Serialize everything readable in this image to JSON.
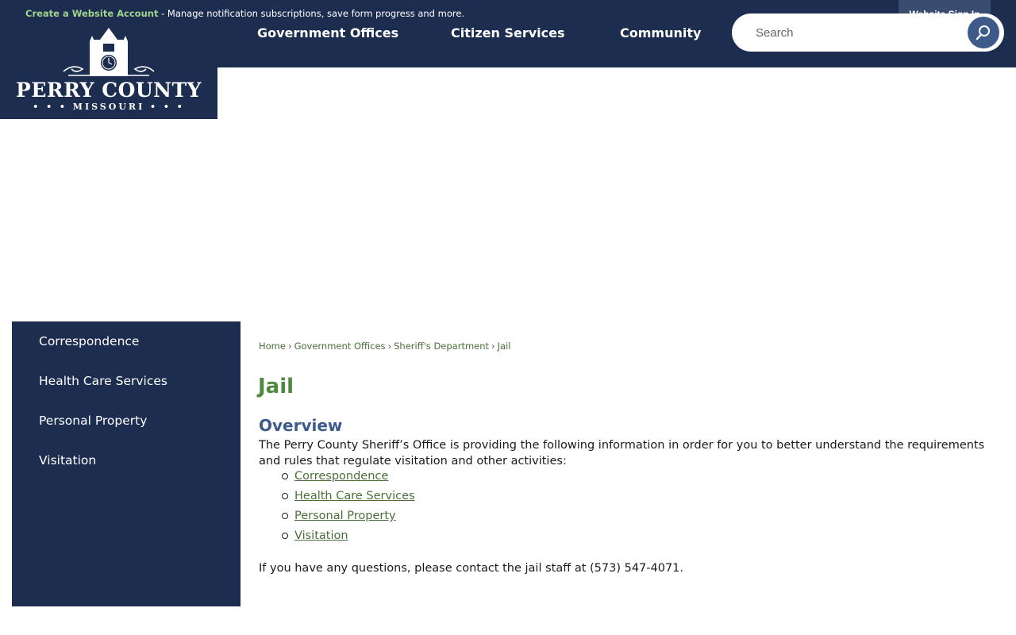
{
  "topbar": {
    "create_account_link": "Create a Website Account",
    "notice_text": " - Manage notification subscriptions, save form progress and more.",
    "sign_in": "Website Sign In"
  },
  "logo": {
    "name": "PERRY COUNTY",
    "subtitle": "• • • MISSOURI • • •"
  },
  "nav": {
    "items": [
      {
        "label": "Government Offices"
      },
      {
        "label": "Citizen Services"
      },
      {
        "label": "Community"
      }
    ]
  },
  "search": {
    "placeholder": "Search"
  },
  "sidebar": {
    "items": [
      {
        "label": "Correspondence"
      },
      {
        "label": "Health Care Services"
      },
      {
        "label": "Personal Property"
      },
      {
        "label": "Visitation"
      }
    ]
  },
  "breadcrumb": {
    "items": [
      "Home",
      "Government Offices",
      "Sheriff's Department",
      "Jail"
    ],
    "separator": "›"
  },
  "main": {
    "title": "Jail",
    "section_title": "Overview",
    "intro": "The Perry County Sheriff’s Office is providing the following information in order for you to better understand the requirements and rules that regulate visitation and other activities:",
    "links": [
      {
        "label": "Correspondence"
      },
      {
        "label": "Health Care Services"
      },
      {
        "label": "Personal Property"
      },
      {
        "label": "Visitation"
      }
    ],
    "contact": "If you have any questions, please contact the jail staff at (573) 547-4071."
  },
  "colors": {
    "navy": "#1c2d50",
    "green_title": "#4e8a3e",
    "link_green": "#4a6f3a",
    "section_blue": "#3e5a8a",
    "notice_link": "#9fd38e"
  }
}
